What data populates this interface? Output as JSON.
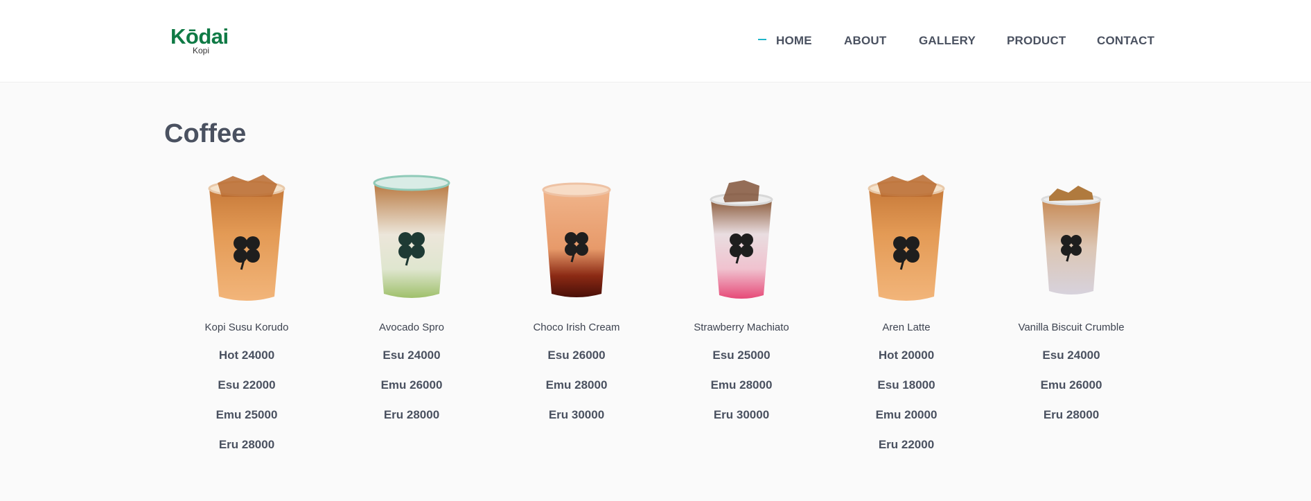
{
  "brand": {
    "name": "Kōdai",
    "sub": "Kopi",
    "color": "#0f7a45"
  },
  "nav": {
    "active_color": "#1fb6c9",
    "items": [
      {
        "label": "HOME",
        "active": true
      },
      {
        "label": "ABOUT"
      },
      {
        "label": "GALLERY"
      },
      {
        "label": "PRODUCT"
      },
      {
        "label": "CONTACT"
      }
    ]
  },
  "section": {
    "title": "Coffee"
  },
  "products": [
    {
      "name": "Kopi Susu Korudo",
      "image": "iced-coffee-cup-icon",
      "prices": [
        "Hot 24000",
        "Esu 22000",
        "Emu 25000",
        "Eru 28000"
      ]
    },
    {
      "name": "Avocado Spro",
      "image": "avocado-espresso-cup-icon",
      "prices": [
        "Esu 24000",
        "Emu 26000",
        "Eru 28000"
      ]
    },
    {
      "name": "Choco Irish Cream",
      "image": "choco-irish-cream-cup-icon",
      "prices": [
        "Esu 26000",
        "Emu 28000",
        "Eru 30000"
      ]
    },
    {
      "name": "Strawberry Machiato",
      "image": "strawberry-machiato-cup-icon",
      "prices": [
        "Esu 25000",
        "Emu 28000",
        "Eru 30000"
      ]
    },
    {
      "name": "Aren Latte",
      "image": "aren-latte-cup-icon",
      "prices": [
        "Hot 20000",
        "Esu 18000",
        "Emu 20000",
        "Eru 22000"
      ]
    },
    {
      "name": "Vanilla Biscuit Crumble",
      "image": "vanilla-biscuit-cup-icon",
      "prices": [
        "Esu 24000",
        "Emu 26000",
        "Eru 28000"
      ]
    }
  ]
}
